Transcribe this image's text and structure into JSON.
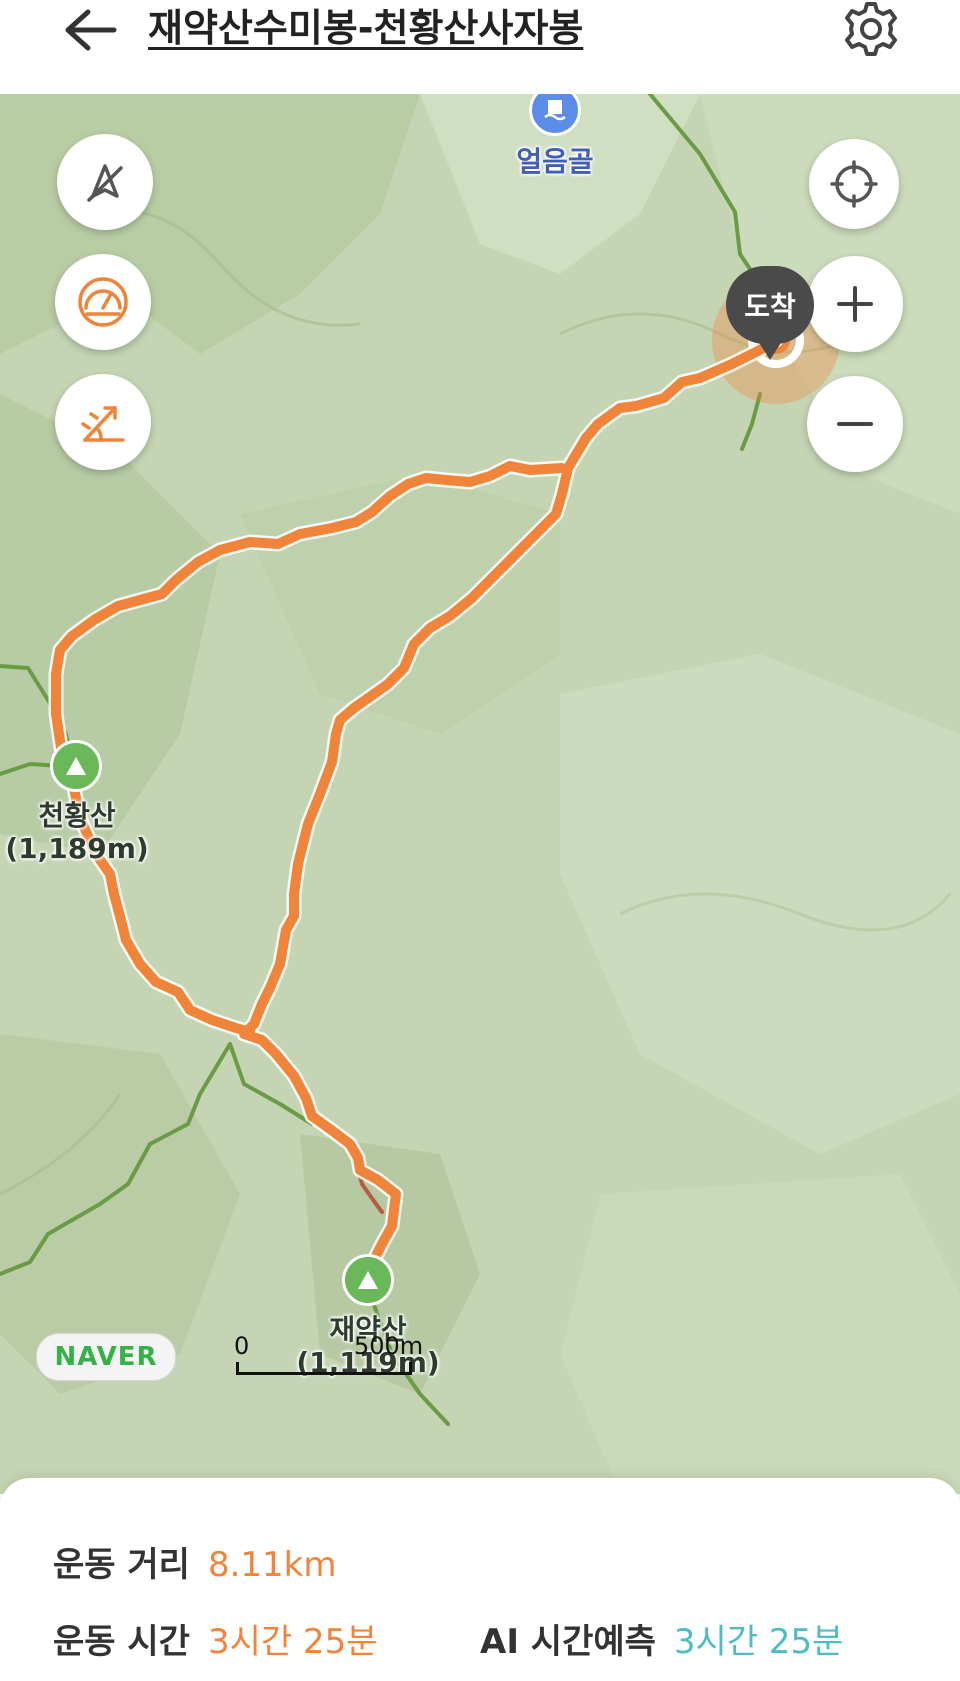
{
  "header": {
    "title": "재약산수미봉-천황산사자봉",
    "back_icon": "arrow-left-icon",
    "settings_icon": "gear-icon"
  },
  "map": {
    "controls_left": [
      {
        "name": "compass-off-icon"
      },
      {
        "name": "speedometer-icon"
      },
      {
        "name": "elevation-chart-icon"
      }
    ],
    "controls_right": [
      {
        "name": "current-location-icon"
      },
      {
        "name": "zoom-in-icon"
      },
      {
        "name": "zoom-out-icon"
      }
    ],
    "labels": {
      "poi_name": "얼음골",
      "peak1_name": "천황산",
      "peak1_height": "(1,189m)",
      "peak2_name": "재약산",
      "peak2_height": "(1,119m)"
    },
    "arrival_label": "도착",
    "brand": "NAVER",
    "scale": {
      "zero": "0",
      "max": "500m"
    },
    "colors": {
      "route": "#f0843a",
      "trail": "#6a9c46",
      "map_bg": "#c3d3b0",
      "arrival_pin": "#4a4a4a"
    }
  },
  "stats": {
    "distance_label": "운동 거리",
    "distance_value": "8.11km",
    "time_label": "운동 시간",
    "time_value": "3시간 25분",
    "ai_label": "AI 시간예측",
    "ai_value": "3시간 25분"
  }
}
